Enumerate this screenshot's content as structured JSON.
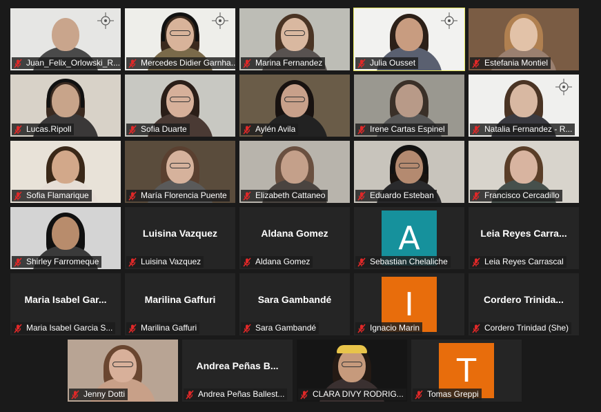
{
  "meeting": {
    "rows": [
      {
        "tiles": [
          {
            "name": "Juan_Felix_Orlowski_R...",
            "kind": "video",
            "skin": "#c9a58c",
            "hair": "#3a2a20",
            "shirt": "#4a4a4a",
            "bg": "#e6e6e4",
            "logo": true,
            "bald": true
          },
          {
            "name": "Mercedes Didier Garnha...",
            "kind": "video",
            "skin": "#d8b39a",
            "hair": "#3b2a1e",
            "shirt": "#7a6a4a",
            "bg": "#eeeeea",
            "logo": true,
            "headphones": true,
            "glasses": true
          },
          {
            "name": "Marina Fernandez",
            "kind": "video",
            "skin": "#d9b8a0",
            "hair": "#4a3424",
            "shirt": "#585250",
            "bg": "#bdbdb6",
            "glasses": true
          },
          {
            "name": "Julia Ousset",
            "kind": "video",
            "skin": "#c89c80",
            "hair": "#2c2018",
            "shirt": "#5a6070",
            "bg": "#f2f2f0",
            "logo": true,
            "active": true
          },
          {
            "name": "Estefania Montiel",
            "kind": "video",
            "skin": "#e2c2a8",
            "hair": "#b08050",
            "shirt": "#9a8070",
            "bg": "#7a5c44"
          }
        ]
      },
      {
        "tiles": [
          {
            "name": "Lucas.Ripoll",
            "kind": "video",
            "skin": "#c8a48a",
            "hair": "#3a2a20",
            "shirt": "#3a3838",
            "bg": "#d8d2c8",
            "headphones": true
          },
          {
            "name": "Sofia Duarte",
            "kind": "video",
            "skin": "#d6b09a",
            "hair": "#2a1e18",
            "shirt": "#4a3a34",
            "bg": "#c8c8c2",
            "glasses": true
          },
          {
            "name": "Aylén Avila",
            "kind": "video",
            "skin": "#c8a08a",
            "hair": "#181210",
            "shirt": "#222222",
            "bg": "#6a5c48",
            "glasses": true
          },
          {
            "name": "Irene Cartas Espinel",
            "kind": "video",
            "skin": "#b89a88",
            "hair": "#3a3028",
            "shirt": "#585858",
            "bg": "#9a9890"
          },
          {
            "name": "Natalia Fernandez - R...",
            "kind": "video",
            "skin": "#d8b8a2",
            "hair": "#4a3424",
            "shirt": "#3a3a40",
            "bg": "#f0f0ee",
            "logo": true
          }
        ]
      },
      {
        "tiles": [
          {
            "name": "Sofia Flamarique",
            "kind": "video",
            "skin": "#d2a88a",
            "hair": "#3a2818",
            "shirt": "#e6ded6",
            "bg": "#e8e2d8"
          },
          {
            "name": "María Florencia Puente",
            "kind": "video",
            "skin": "#d6b29c",
            "hair": "#5a4030",
            "shirt": "#5a5a5a",
            "bg": "#5a4c3c",
            "glasses": true
          },
          {
            "name": "Elizabeth Cattaneo",
            "kind": "video",
            "skin": "#c4a08a",
            "hair": "#6a5040",
            "shirt": "#4a4440",
            "bg": "#b8b4ac"
          },
          {
            "name": "Eduardo Esteban",
            "kind": "video",
            "skin": "#b48a70",
            "hair": "#1a1410",
            "shirt": "#2a2a2c",
            "bg": "#c8c4bc",
            "headphones": true,
            "glasses": true
          },
          {
            "name": "Francisco Cercadillo",
            "kind": "video",
            "skin": "#d8b4a0",
            "hair": "#5a3e28",
            "shirt": "#46504c",
            "bg": "#d8d4cc"
          }
        ]
      },
      {
        "tiles": [
          {
            "name": "Shirley Farromeque",
            "kind": "video",
            "skin": "#b88c6c",
            "hair": "#101010",
            "shirt": "#3a3a3a",
            "bg": "#d4d4d4"
          },
          {
            "name": "Luisina Vazquez",
            "kind": "name",
            "display": "Luisina Vazquez"
          },
          {
            "name": "Aldana Gomez",
            "kind": "name",
            "display": "Aldana Gomez"
          },
          {
            "name": "Sebastian Chelaliche",
            "kind": "avatar",
            "letter": "A",
            "color": "#16919c"
          },
          {
            "name": "Leia Reyes Carrascal",
            "kind": "name",
            "display": "Leia Reyes Carra..."
          }
        ]
      },
      {
        "tiles": [
          {
            "name": "Maria Isabel Garcia S...",
            "kind": "name",
            "display": "Maria Isabel Gar..."
          },
          {
            "name": "Marilina Gaffuri",
            "kind": "name",
            "display": "Marilina Gaffuri"
          },
          {
            "name": "Sara Gambandé",
            "kind": "name",
            "display": "Sara Gambandé"
          },
          {
            "name": "Ignacio Marin",
            "kind": "avatar",
            "letter": "I",
            "color": "#e86d0c"
          },
          {
            "name": "Cordero Trinidad (She)",
            "kind": "name",
            "display": "Cordero Trinida..."
          }
        ]
      },
      {
        "tiles": [
          {
            "name": "Jenny Dotti",
            "kind": "video",
            "skin": "#d8b09a",
            "hair": "#6a4630",
            "shirt": "#c8a088",
            "bg": "#b8a494",
            "glasses": true
          },
          {
            "name": "Andrea Peñas Ballest...",
            "kind": "name",
            "display": "Andrea Peñas B..."
          },
          {
            "name": "CLARA DIVY RODRIG...",
            "kind": "video",
            "skin": "#c69a7c",
            "hair": "#241a14",
            "shirt": "#3a3030",
            "bg": "#151515",
            "cap": true,
            "glasses": true
          },
          {
            "name": "Tomas Greppi",
            "kind": "avatar",
            "letter": "T",
            "color": "#e86d0c"
          }
        ]
      }
    ]
  }
}
